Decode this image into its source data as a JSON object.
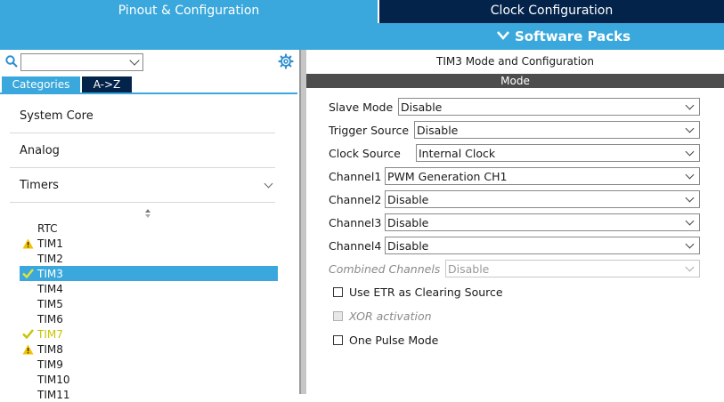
{
  "top_tabs": {
    "pinout": "Pinout & Configuration",
    "clock": "Clock Configuration",
    "software_packs": "Software Packs"
  },
  "left_panel": {
    "search": {
      "value": "",
      "placeholder": ""
    },
    "tabs": {
      "categories": "Categories",
      "az": "A->Z"
    },
    "categories": [
      {
        "label": "System Core",
        "expanded": false
      },
      {
        "label": "Analog",
        "expanded": false
      },
      {
        "label": "Timers",
        "expanded": true
      }
    ],
    "timers": [
      {
        "label": "RTC",
        "status": "none"
      },
      {
        "label": "TIM1",
        "status": "warning"
      },
      {
        "label": "TIM2",
        "status": "none"
      },
      {
        "label": "TIM3",
        "status": "ok",
        "selected": true
      },
      {
        "label": "TIM4",
        "status": "none"
      },
      {
        "label": "TIM5",
        "status": "none"
      },
      {
        "label": "TIM6",
        "status": "none"
      },
      {
        "label": "TIM7",
        "status": "ok"
      },
      {
        "label": "TIM8",
        "status": "warning"
      },
      {
        "label": "TIM9",
        "status": "none"
      },
      {
        "label": "TIM10",
        "status": "none"
      },
      {
        "label": "TIM11",
        "status": "none"
      }
    ]
  },
  "right_panel": {
    "title": "TIM3 Mode and Configuration",
    "mode_header": "Mode",
    "fields": {
      "slave_mode": {
        "label": "Slave Mode",
        "value": "Disable"
      },
      "trigger_source": {
        "label": "Trigger Source",
        "value": "Disable"
      },
      "clock_source": {
        "label": "Clock Source",
        "value": "Internal Clock"
      },
      "channel1": {
        "label": "Channel1",
        "value": "PWM Generation CH1"
      },
      "channel2": {
        "label": "Channel2",
        "value": "Disable"
      },
      "channel3": {
        "label": "Channel3",
        "value": "Disable"
      },
      "channel4": {
        "label": "Channel4",
        "value": "Disable"
      },
      "combined_channels": {
        "label": "Combined Channels",
        "value": "Disable",
        "enabled": false
      }
    },
    "checkboxes": {
      "use_etr": {
        "label": "Use ETR as Clearing Source",
        "checked": false,
        "enabled": true
      },
      "xor": {
        "label": "XOR activation",
        "checked": false,
        "enabled": false
      },
      "one_pulse": {
        "label": "One Pulse Mode",
        "checked": false,
        "enabled": true
      }
    }
  },
  "colors": {
    "accent_blue": "#3aa8dc",
    "dark_navy": "#03234b",
    "mode_bar": "#4d4d4d",
    "warning": "#f2c200",
    "ok": "#c9c400"
  }
}
